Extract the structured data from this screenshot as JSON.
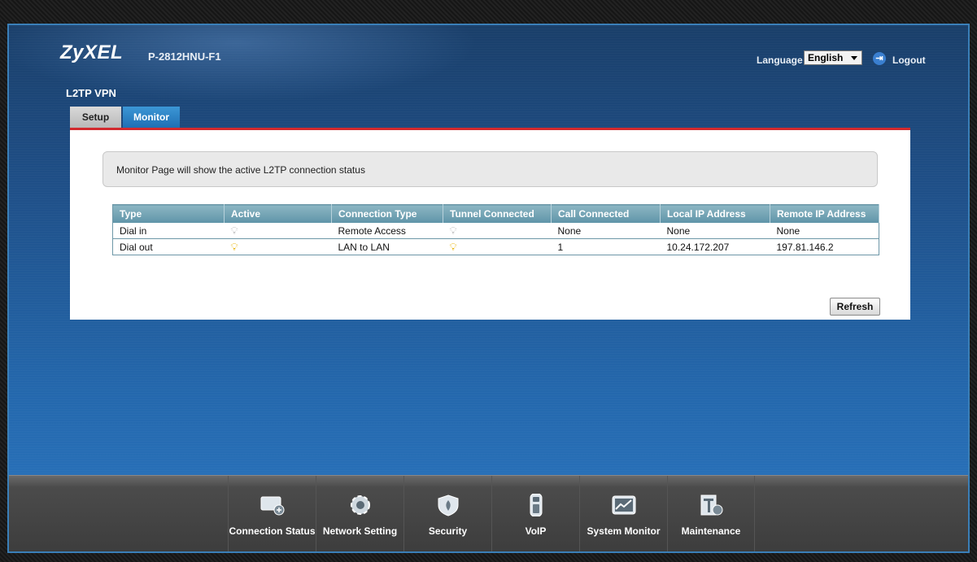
{
  "header": {
    "brand": "ZyXEL",
    "model": "P-2812HNU-F1",
    "language_label": "Language :",
    "language_value": "English",
    "logout_label": "Logout"
  },
  "page": {
    "title": "L2TP VPN",
    "tabs": [
      {
        "label": "Setup",
        "active": false
      },
      {
        "label": "Monitor",
        "active": true
      }
    ],
    "info_text": "Monitor Page will show the active L2TP connection status"
  },
  "table": {
    "headers": [
      "Type",
      "Active",
      "Connection Type",
      "Tunnel Connected",
      "Call Connected",
      "Local IP Address",
      "Remote IP Address"
    ],
    "rows": [
      {
        "type": "Dial in",
        "active": "off",
        "connection_type": "Remote Access",
        "tunnel_connected": "off",
        "call_connected": "None",
        "local_ip": "None",
        "remote_ip": "None"
      },
      {
        "type": "Dial out",
        "active": "on",
        "connection_type": "LAN to LAN",
        "tunnel_connected": "on",
        "call_connected": "1",
        "local_ip": "10.24.172.207",
        "remote_ip": "197.81.146.2"
      }
    ]
  },
  "refresh_label": "Refresh",
  "nav": [
    {
      "label": "Connection Status",
      "icon": "connection-status-icon"
    },
    {
      "label": "Network Setting",
      "icon": "gear-icon"
    },
    {
      "label": "Security",
      "icon": "shield-icon"
    },
    {
      "label": "VoIP",
      "icon": "phone-icon"
    },
    {
      "label": "System Monitor",
      "icon": "monitor-chart-icon"
    },
    {
      "label": "Maintenance",
      "icon": "maintenance-icon"
    }
  ],
  "colors": {
    "accent_red": "#d22a2e",
    "tab_active": "#1f6fb3",
    "table_header": "#5f94a8",
    "bulb_on": "#e8b200",
    "bulb_off": "#bbbbbb"
  }
}
